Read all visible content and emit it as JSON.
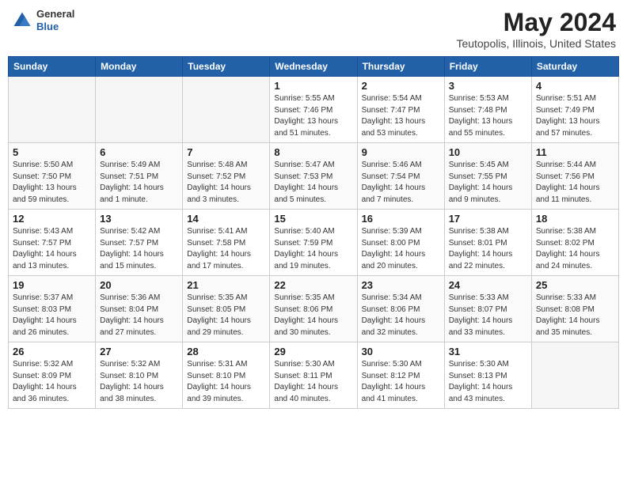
{
  "header": {
    "logo_general": "General",
    "logo_blue": "Blue",
    "title": "May 2024",
    "subtitle": "Teutopolis, Illinois, United States"
  },
  "weekdays": [
    "Sunday",
    "Monday",
    "Tuesday",
    "Wednesday",
    "Thursday",
    "Friday",
    "Saturday"
  ],
  "weeks": [
    [
      {
        "day": "",
        "info": ""
      },
      {
        "day": "",
        "info": ""
      },
      {
        "day": "",
        "info": ""
      },
      {
        "day": "1",
        "info": "Sunrise: 5:55 AM\nSunset: 7:46 PM\nDaylight: 13 hours\nand 51 minutes."
      },
      {
        "day": "2",
        "info": "Sunrise: 5:54 AM\nSunset: 7:47 PM\nDaylight: 13 hours\nand 53 minutes."
      },
      {
        "day": "3",
        "info": "Sunrise: 5:53 AM\nSunset: 7:48 PM\nDaylight: 13 hours\nand 55 minutes."
      },
      {
        "day": "4",
        "info": "Sunrise: 5:51 AM\nSunset: 7:49 PM\nDaylight: 13 hours\nand 57 minutes."
      }
    ],
    [
      {
        "day": "5",
        "info": "Sunrise: 5:50 AM\nSunset: 7:50 PM\nDaylight: 13 hours\nand 59 minutes."
      },
      {
        "day": "6",
        "info": "Sunrise: 5:49 AM\nSunset: 7:51 PM\nDaylight: 14 hours\nand 1 minute."
      },
      {
        "day": "7",
        "info": "Sunrise: 5:48 AM\nSunset: 7:52 PM\nDaylight: 14 hours\nand 3 minutes."
      },
      {
        "day": "8",
        "info": "Sunrise: 5:47 AM\nSunset: 7:53 PM\nDaylight: 14 hours\nand 5 minutes."
      },
      {
        "day": "9",
        "info": "Sunrise: 5:46 AM\nSunset: 7:54 PM\nDaylight: 14 hours\nand 7 minutes."
      },
      {
        "day": "10",
        "info": "Sunrise: 5:45 AM\nSunset: 7:55 PM\nDaylight: 14 hours\nand 9 minutes."
      },
      {
        "day": "11",
        "info": "Sunrise: 5:44 AM\nSunset: 7:56 PM\nDaylight: 14 hours\nand 11 minutes."
      }
    ],
    [
      {
        "day": "12",
        "info": "Sunrise: 5:43 AM\nSunset: 7:57 PM\nDaylight: 14 hours\nand 13 minutes."
      },
      {
        "day": "13",
        "info": "Sunrise: 5:42 AM\nSunset: 7:57 PM\nDaylight: 14 hours\nand 15 minutes."
      },
      {
        "day": "14",
        "info": "Sunrise: 5:41 AM\nSunset: 7:58 PM\nDaylight: 14 hours\nand 17 minutes."
      },
      {
        "day": "15",
        "info": "Sunrise: 5:40 AM\nSunset: 7:59 PM\nDaylight: 14 hours\nand 19 minutes."
      },
      {
        "day": "16",
        "info": "Sunrise: 5:39 AM\nSunset: 8:00 PM\nDaylight: 14 hours\nand 20 minutes."
      },
      {
        "day": "17",
        "info": "Sunrise: 5:38 AM\nSunset: 8:01 PM\nDaylight: 14 hours\nand 22 minutes."
      },
      {
        "day": "18",
        "info": "Sunrise: 5:38 AM\nSunset: 8:02 PM\nDaylight: 14 hours\nand 24 minutes."
      }
    ],
    [
      {
        "day": "19",
        "info": "Sunrise: 5:37 AM\nSunset: 8:03 PM\nDaylight: 14 hours\nand 26 minutes."
      },
      {
        "day": "20",
        "info": "Sunrise: 5:36 AM\nSunset: 8:04 PM\nDaylight: 14 hours\nand 27 minutes."
      },
      {
        "day": "21",
        "info": "Sunrise: 5:35 AM\nSunset: 8:05 PM\nDaylight: 14 hours\nand 29 minutes."
      },
      {
        "day": "22",
        "info": "Sunrise: 5:35 AM\nSunset: 8:06 PM\nDaylight: 14 hours\nand 30 minutes."
      },
      {
        "day": "23",
        "info": "Sunrise: 5:34 AM\nSunset: 8:06 PM\nDaylight: 14 hours\nand 32 minutes."
      },
      {
        "day": "24",
        "info": "Sunrise: 5:33 AM\nSunset: 8:07 PM\nDaylight: 14 hours\nand 33 minutes."
      },
      {
        "day": "25",
        "info": "Sunrise: 5:33 AM\nSunset: 8:08 PM\nDaylight: 14 hours\nand 35 minutes."
      }
    ],
    [
      {
        "day": "26",
        "info": "Sunrise: 5:32 AM\nSunset: 8:09 PM\nDaylight: 14 hours\nand 36 minutes."
      },
      {
        "day": "27",
        "info": "Sunrise: 5:32 AM\nSunset: 8:10 PM\nDaylight: 14 hours\nand 38 minutes."
      },
      {
        "day": "28",
        "info": "Sunrise: 5:31 AM\nSunset: 8:10 PM\nDaylight: 14 hours\nand 39 minutes."
      },
      {
        "day": "29",
        "info": "Sunrise: 5:30 AM\nSunset: 8:11 PM\nDaylight: 14 hours\nand 40 minutes."
      },
      {
        "day": "30",
        "info": "Sunrise: 5:30 AM\nSunset: 8:12 PM\nDaylight: 14 hours\nand 41 minutes."
      },
      {
        "day": "31",
        "info": "Sunrise: 5:30 AM\nSunset: 8:13 PM\nDaylight: 14 hours\nand 43 minutes."
      },
      {
        "day": "",
        "info": ""
      }
    ]
  ]
}
